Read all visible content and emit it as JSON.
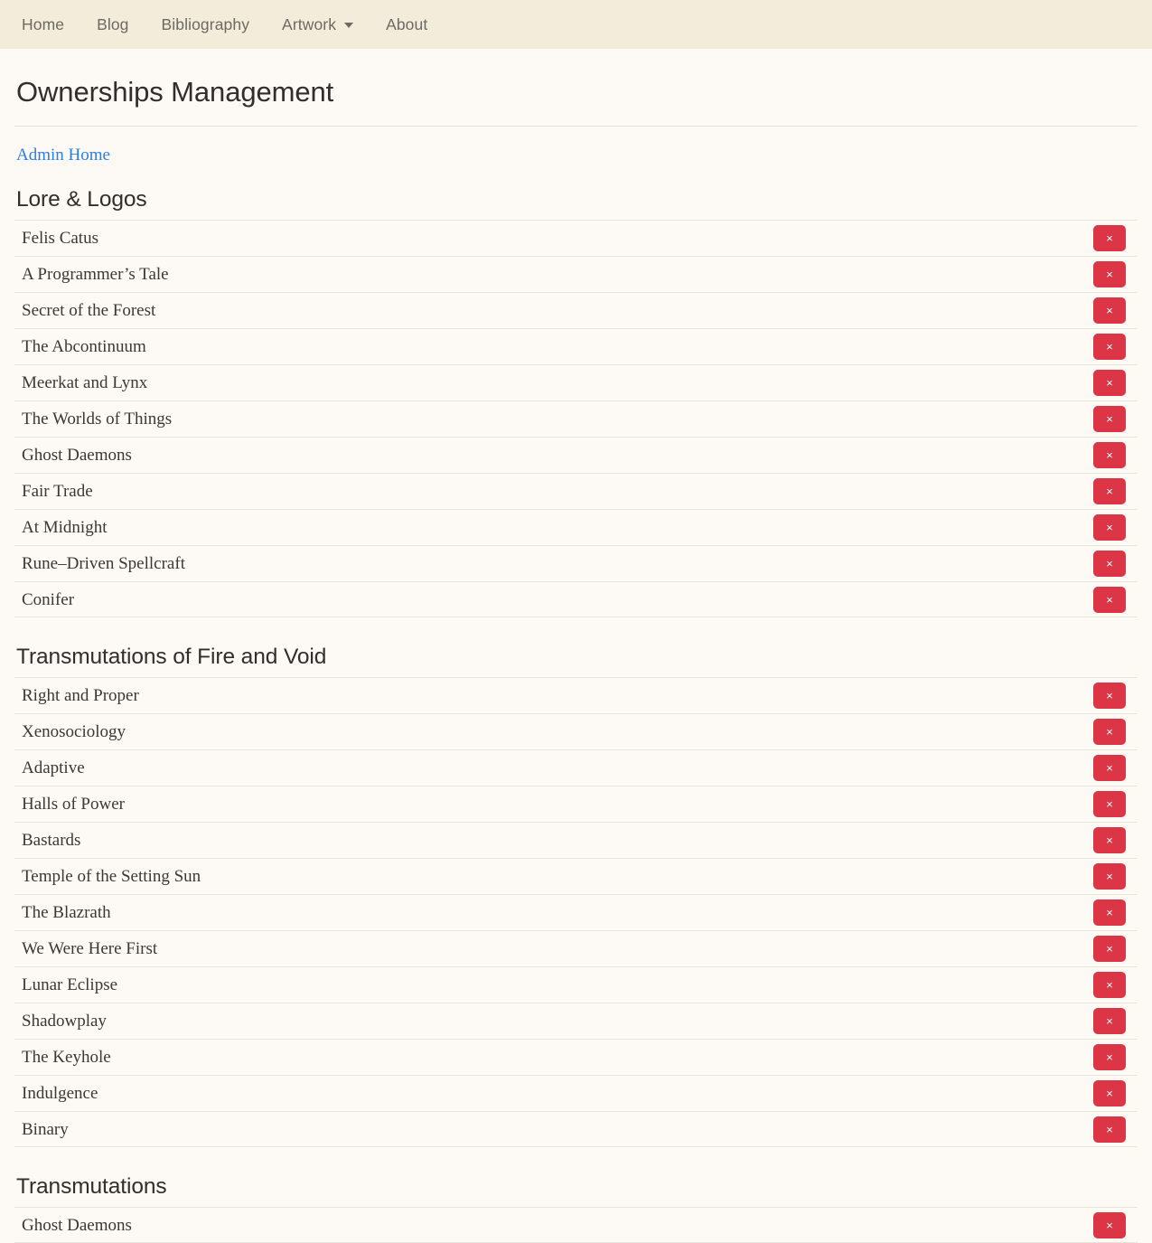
{
  "nav": {
    "items": [
      {
        "label": "Home",
        "name": "nav-link-home"
      },
      {
        "label": "Blog",
        "name": "nav-link-blog"
      },
      {
        "label": "Bibliography",
        "name": "nav-link-bibliography"
      }
    ],
    "dropdown": {
      "label": "Artwork",
      "caret": "chevron-down-icon"
    },
    "last": {
      "label": "About",
      "name": "nav-link-about"
    }
  },
  "page": {
    "title": "Ownerships Management",
    "admin_link": "Admin Home"
  },
  "delete_button": {
    "glyph": "×",
    "color": "#dc3545"
  },
  "sections": [
    {
      "heading": "Lore & Logos",
      "items": [
        "Felis Catus",
        "A Programmer’s Tale",
        "Secret of the Forest",
        "The Abcontinuum",
        "Meerkat and Lynx",
        "The Worlds of Things",
        "Ghost Daemons",
        "Fair Trade",
        "At Midnight",
        "Rune–Driven Spellcraft",
        "Conifer"
      ]
    },
    {
      "heading": "Transmutations of Fire and Void",
      "items": [
        "Right and Proper",
        "Xenosociology",
        "Adaptive",
        "Halls of Power",
        "Bastards",
        "Temple of the Setting Sun",
        "The Blazrath",
        "We Were Here First",
        "Lunar Eclipse",
        "Shadowplay",
        "The Keyhole",
        "Indulgence",
        "Binary"
      ]
    },
    {
      "heading": "Transmutations",
      "items": [
        "Ghost Daemons"
      ]
    }
  ]
}
